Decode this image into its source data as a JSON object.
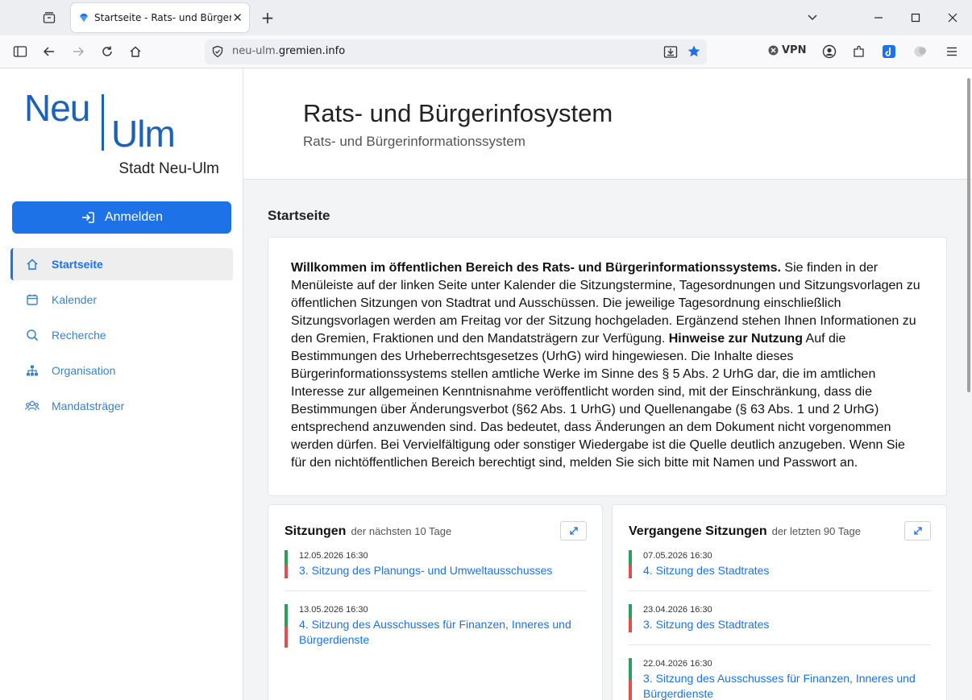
{
  "browser": {
    "tab_title": "Startseite - Rats- und Bürgerinfosystem",
    "url_prefix": "neu-ulm.",
    "url_domain": "gremien.info",
    "vpn_label": "VPN"
  },
  "sidebar": {
    "logo_neu": "Neu",
    "logo_ulm": "Ulm",
    "logo_stadt": "Stadt Neu-Ulm",
    "login_label": "Anmelden",
    "items": [
      {
        "label": "Startseite",
        "icon": "home-icon",
        "active": true
      },
      {
        "label": "Kalender",
        "icon": "calendar-icon",
        "active": false
      },
      {
        "label": "Recherche",
        "icon": "search-icon",
        "active": false
      },
      {
        "label": "Organisation",
        "icon": "sitemap-icon",
        "active": false
      },
      {
        "label": "Mandatsträger",
        "icon": "people-icon",
        "active": false
      }
    ]
  },
  "header": {
    "title": "Rats- und Bürgerinfosystem",
    "subtitle": "Rats- und Bürgerinformationssystem"
  },
  "main": {
    "page_title": "Startseite",
    "welcome_bold": "Willkommen im öffentlichen Bereich des Rats- und Bürgerinformationssystems.",
    "welcome_text1": " Sie finden in der Menüleiste auf der linken Seite unter Kalender die Sitzungstermine, Tagesordnungen und Sitzungsvorlagen zu öffentlichen Sitzungen von Stadtrat und Ausschüssen. Die jeweilige Tagesordnung einschließlich Sitzungsvorlagen werden am Freitag vor der Sitzung hochgeladen. Ergänzend stehen Ihnen Informationen zu den Gremien, Fraktionen und den Mandatsträgern zur Verfügung. ",
    "hint_bold": "Hinweise zur Nutzung",
    "welcome_text2": " Auf die Bestimmungen des Urheberrechtsgesetzes (UrhG) wird hingewiesen. Die Inhalte dieses Bürgerinformationssystems stellen amtliche Werke im Sinne des § 5 Abs. 2 UrhG dar, die im amtlichen Interesse zur allgemeinen Kenntnisnahme veröffentlicht worden sind, mit der Einschränkung, dass die Bestimmungen über Änderungsverbot (§62 Abs. 1 UrhG) und Quellenangabe (§ 63 Abs. 1 und 2 UrhG) entsprechend anzuwenden sind. Das bedeutet, dass Änderungen an dem Dokument nicht vorgenommen werden dürfen. Bei Vervielfältigung oder sonstiger Wiedergabe ist die Quelle deutlich anzugeben. Wenn Sie für den nichtöffentlichen Bereich berechtigt sind, melden Sie sich bitte mit Namen und Passwort an."
  },
  "upcoming": {
    "title": "Sitzungen",
    "subtitle": "der nächsten 10 Tage",
    "sessions": [
      {
        "date": "12.05.2026 16:30",
        "name": "3. Sitzung des Planungs- und Umweltausschusses"
      },
      {
        "date": "13.05.2026 16:30",
        "name": "4. Sitzung des Ausschusses für Finanzen, Inneres und Bürgerdienste"
      }
    ]
  },
  "past": {
    "title": "Vergangene Sitzungen",
    "subtitle": "der letzten 90 Tage",
    "sessions": [
      {
        "date": "07.05.2026 16:30",
        "name": "4. Sitzung des Stadtrates"
      },
      {
        "date": "23.04.2026 16:30",
        "name": "3. Sitzung des Stadtrates"
      },
      {
        "date": "22.04.2026 16:30",
        "name": "3. Sitzung des Ausschusses für Finanzen, Inneres und Bürgerdienste"
      }
    ]
  },
  "colors": {
    "accent": "#1d72e8",
    "logo_blue": "#1c63b7",
    "stripe_green": "#2e9e5b",
    "stripe_red": "#d9534f"
  }
}
